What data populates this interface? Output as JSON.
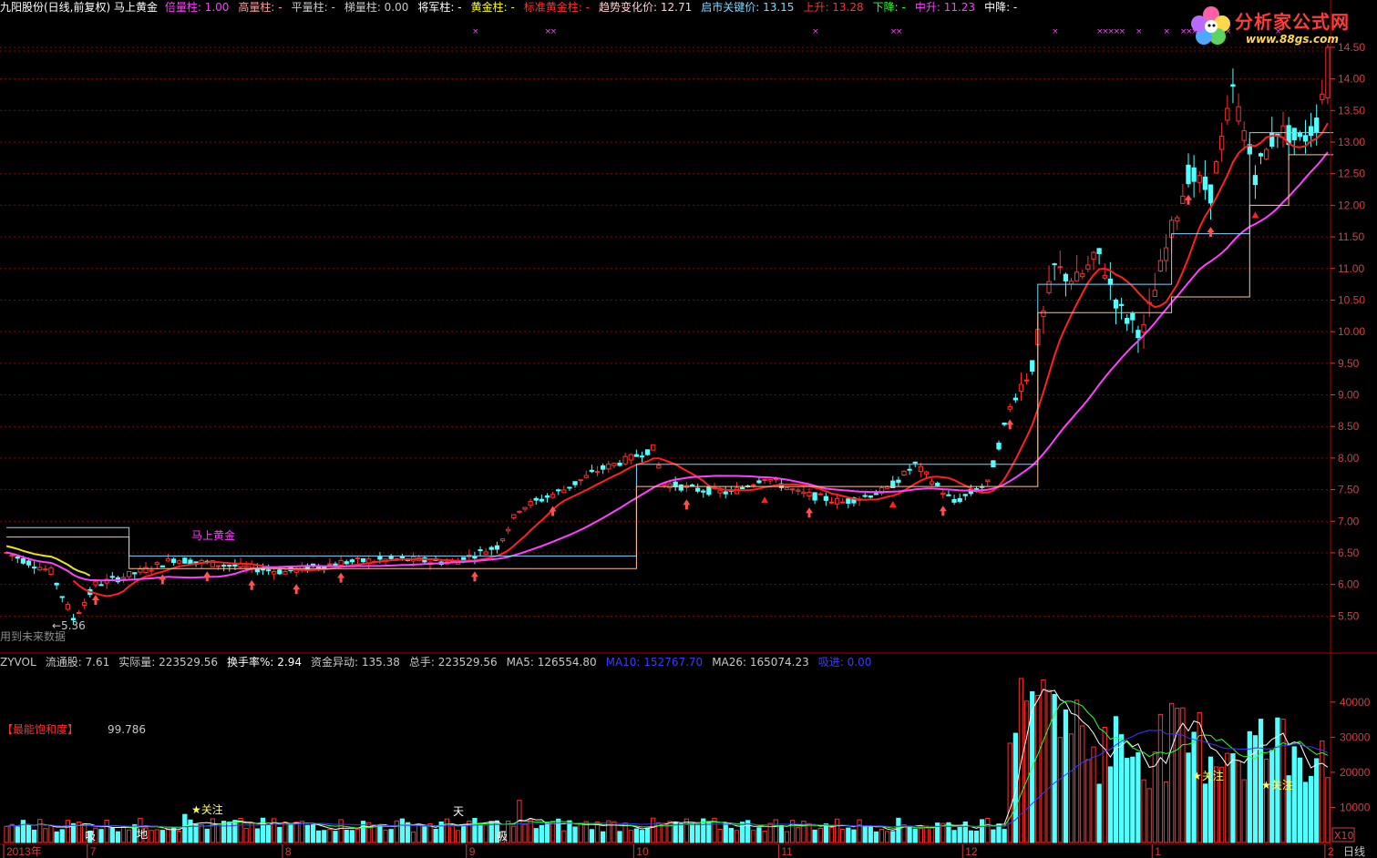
{
  "header": {
    "title": "九阳股份(日线,前复权) 马上黄金",
    "items": [
      {
        "label": "倍量柱:",
        "value": "1.00",
        "color": "#ff40ff"
      },
      {
        "label": "高量柱:",
        "value": "-",
        "color": "#ff9a9a"
      },
      {
        "label": "平量柱:",
        "value": "-",
        "color": "#c8c8c8"
      },
      {
        "label": "梯量柱:",
        "value": "0.00",
        "color": "#c8c8c8"
      },
      {
        "label": "将军柱:",
        "value": "-",
        "color": "#ffffff"
      },
      {
        "label": "黄金柱:",
        "value": "-",
        "color": "#ffff00"
      },
      {
        "label": "标准黄金柱:",
        "value": "-",
        "color": "#ff3030"
      },
      {
        "label": "趋势变化价:",
        "value": "12.71",
        "color": "#ffd0d0"
      },
      {
        "label": "启市关键价:",
        "value": "13.15",
        "color": "#7fd6ff"
      },
      {
        "label": "上升:",
        "value": "13.28",
        "color": "#ff3030"
      },
      {
        "label": "下降:",
        "value": "-",
        "color": "#30ff30"
      },
      {
        "label": "中升:",
        "value": "11.23",
        "color": "#ff40ff"
      },
      {
        "label": "中降:",
        "value": "-",
        "color": "#ffffff"
      }
    ]
  },
  "logo": {
    "title": "分析家公式网",
    "url": "www.88gs.com"
  },
  "annotations": {
    "indicator_name": "马上黄金",
    "low_label": "←5.36",
    "future_note": "用到未来数据",
    "saturation_label": "【最能饱和度】",
    "saturation_value": "99.786",
    "watch": "★关注",
    "suck": "吸",
    "sky": "天",
    "earth": "地",
    "x10": "X10",
    "timeframe": "日线"
  },
  "subheader": {
    "items": [
      {
        "label": "ZYVOL",
        "value": "",
        "color": "#c8c8c8"
      },
      {
        "label": "流通股:",
        "value": "7.61",
        "color": "#c8c8c8"
      },
      {
        "label": "实际量:",
        "value": "223529.56",
        "color": "#c8c8c8"
      },
      {
        "label": "换手率%:",
        "value": "2.94",
        "color": "#ffffff"
      },
      {
        "label": "资金异动:",
        "value": "135.38",
        "color": "#c8c8c8"
      },
      {
        "label": "总手:",
        "value": "223529.56",
        "color": "#c8c8c8"
      },
      {
        "label": "MA5:",
        "value": "126554.80",
        "color": "#c8c8c8"
      },
      {
        "label": "MA10:",
        "value": "152767.70",
        "color": "#3a3aff"
      },
      {
        "label": "MA26:",
        "value": "165074.23",
        "color": "#c8c8c8"
      },
      {
        "label": "吸进:",
        "value": "0.00",
        "color": "#3a3aff"
      }
    ]
  },
  "colors": {
    "up": "#ff3030",
    "down": "#54ffff",
    "grid": "#8a0000",
    "axis": "#b00000",
    "tick": "#d04040"
  },
  "chart_data": [
    {
      "type": "candlestick",
      "name": "price",
      "title": "九阳股份(日线,前复权) 马上黄金",
      "ylim": [
        5.0,
        14.6
      ],
      "yticks": [
        "5.50",
        "6.00",
        "6.50",
        "7.00",
        "7.50",
        "8.00",
        "8.50",
        "9.00",
        "9.50",
        "10.00",
        "10.50",
        "11.00",
        "11.50",
        "12.00",
        "12.50",
        "13.00",
        "13.50",
        "14.00",
        "14.50"
      ],
      "x_labels": [
        "2013年",
        "7",
        "8",
        "9",
        "10",
        "11",
        "12",
        "1",
        "2"
      ],
      "x_label_bars": [
        0,
        15,
        50,
        83,
        113,
        139,
        172,
        206,
        237
      ],
      "bar_count": 238,
      "key_points": {
        "low": 5.36,
        "last_close": 13.7,
        "high": 14.55
      },
      "grid": true
    },
    {
      "type": "bar",
      "name": "volume",
      "ylim": [
        0,
        48000
      ],
      "yticks": [
        "10000",
        "20000",
        "30000",
        "40000"
      ],
      "series": [
        "MA5",
        "MA10",
        "MA26"
      ],
      "grid": false
    }
  ]
}
